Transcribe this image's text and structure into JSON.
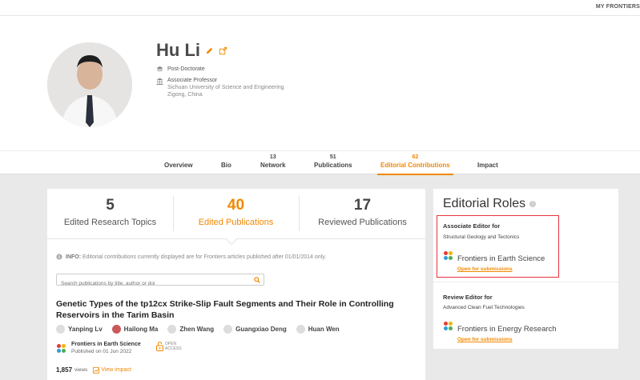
{
  "topbar": {
    "my_frontiers": "MY FRONTIERS"
  },
  "profile": {
    "name": "Hu Li",
    "degree": "Post-Doctorate",
    "position": "Associate Professor",
    "institution": "Sichuan University of Science and Engineering",
    "location": "Zigong, China"
  },
  "tabs": [
    {
      "label": "Overview",
      "count": ""
    },
    {
      "label": "Bio",
      "count": ""
    },
    {
      "label": "Network",
      "count": "13"
    },
    {
      "label": "Publications",
      "count": "51"
    },
    {
      "label": "Editorial Contributions",
      "count": "62"
    },
    {
      "label": "Impact",
      "count": ""
    }
  ],
  "stats": [
    {
      "number": "5",
      "label": "Edited Research Topics"
    },
    {
      "number": "40",
      "label": "Edited Publications"
    },
    {
      "number": "17",
      "label": "Reviewed Publications"
    }
  ],
  "info": {
    "prefix": "INFO:",
    "text": "Editorial contributions currently displayed are for Frontiers articles published after 01/01/2014 only."
  },
  "search": {
    "placeholder": "Search publications by title, author or doi"
  },
  "article": {
    "title": "Genetic Types of the tp12cx Strike-Slip Fault Segments and Their Role in Controlling Reservoirs in the Tarim Basin",
    "authors": [
      "Yanping Lv",
      "Hailong Ma",
      "Zhen Wang",
      "Guangxiao Deng",
      "Huan Wen"
    ],
    "journal": "Frontiers in Earth Science",
    "published": "Published on 01 Jun 2022",
    "open_access": [
      "OPEN",
      "ACCESS"
    ],
    "views_count": "1,857",
    "views_label": "views",
    "view_impact": "View impact"
  },
  "roles": {
    "title": "Editorial Roles",
    "associate_heading": "Associate Editor for",
    "associate_section": "Structural Geology and Tectonics",
    "associate_journal": "Frontiers in Earth Science",
    "associate_status": "Open for submissions",
    "review_heading": "Review Editor for",
    "review_section": "Advanced Clean Fuel Technologies",
    "review_journal": "Frontiers in Energy Research",
    "review_status": "Open for submissions"
  },
  "colors": {
    "accent": "#f18800",
    "highlight_border": "#e8323c"
  }
}
